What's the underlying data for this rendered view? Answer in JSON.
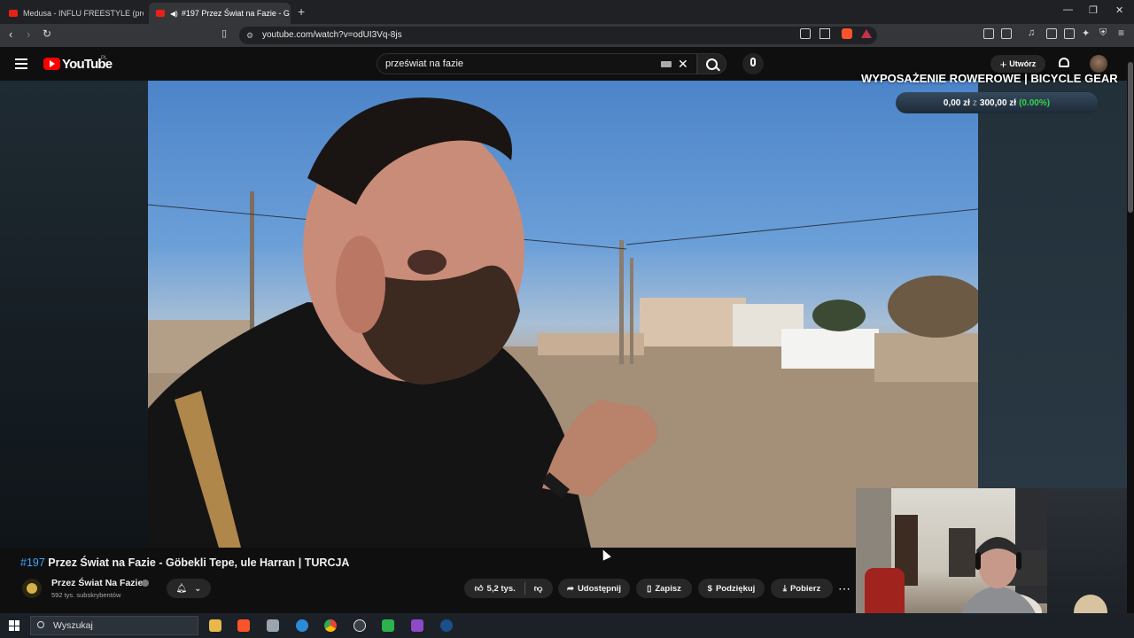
{
  "browser": {
    "tabs": [
      {
        "label": "Medusa - INFLU FREESTYLE (prod. VI",
        "active": false
      },
      {
        "label": "#197 Przez Świat na Fazie - G",
        "active": true
      }
    ],
    "new_tab": "+",
    "url": "youtube.com/watch?v=odUI3Vq-8js",
    "window_controls": {
      "minimize": "—",
      "maximize": "❐",
      "close": "✕"
    }
  },
  "youtube": {
    "logo_text": "YouTube",
    "logo_region": "PL",
    "search": {
      "value": "przeświat na fazie",
      "clear": "✕"
    },
    "create_label": "Utwórz",
    "create_plus": "+"
  },
  "overlay": {
    "goal_title": "WYPOSAŻENIE ROWEROWE | BICYCLE GEAR",
    "goal_current": "0,00 zł",
    "goal_sep": "z",
    "goal_target": "300,00 zł",
    "goal_percent": "(0.00%)",
    "goal_progress": 0.0
  },
  "video": {
    "hashtag": "#197",
    "title": "Przez Świat na Fazie - Göbekli Tepe, ule Harran | TURCJA",
    "channel": {
      "name": "Przez Świat Na Fazie",
      "subscribers": "592 tys. subskrybentów"
    },
    "actions": {
      "likes": "5,2 tys.",
      "share": "Udostępnij",
      "save": "Zapisz",
      "thanks": "Podziękuj",
      "download": "Pobierz",
      "more": "⋯"
    }
  },
  "taskbar": {
    "search_placeholder": "Wyszukaj"
  },
  "colors": {
    "youtube_red": "#ff0000",
    "hashtag_blue": "#3ea6ff",
    "goal_green": "#35d34a"
  }
}
